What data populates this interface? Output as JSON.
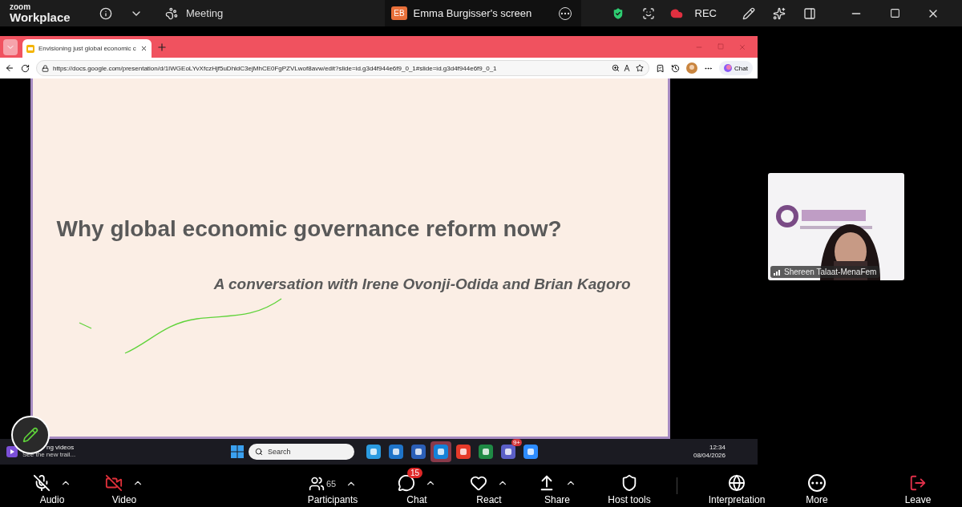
{
  "top_bar": {
    "brand_small": "zoom",
    "brand_large": "Workplace",
    "meeting_label": "Meeting",
    "share_tab": {
      "initials": "EB",
      "title": "Emma Burgisser's screen"
    },
    "rec_label": "REC"
  },
  "browser": {
    "tab_title": "Envisioning just global economic c",
    "url": "https://docs.google.com/presentation/d/1IWGEoLYvXfczHjf5uDhldC3ejMhCE0FgPZVLwof8avw/edit?slide=id.g3d4f944e6f9_0_1#slide=id.g3d4f944e6f9_0_1",
    "chat_label": "Chat"
  },
  "slide": {
    "title": "Why global economic governance reform now?",
    "subtitle": "A conversation with Irene Ovonji-Odida and Brian Kagoro"
  },
  "taskbar": {
    "notification": {
      "title": "ng videos",
      "subtitle": "See the new trail..."
    },
    "search_placeholder": "Search",
    "apps": [
      {
        "kind": "edge",
        "selected": false
      },
      {
        "kind": "people",
        "selected": false
      },
      {
        "kind": "word",
        "selected": false
      },
      {
        "kind": "outlook",
        "selected": true
      },
      {
        "kind": "pdf",
        "selected": false
      },
      {
        "kind": "excel",
        "selected": false
      },
      {
        "kind": "teams",
        "selected": false,
        "badge": "9+"
      },
      {
        "kind": "zoom",
        "selected": false
      }
    ],
    "time": "12:34",
    "date": "08/04/2026"
  },
  "participant_video": {
    "name": "Shereen Talaat-MenaFem"
  },
  "toolbar": {
    "items": [
      {
        "kind": "audio",
        "label": "Audio",
        "off": true,
        "caret": true
      },
      {
        "kind": "video",
        "label": "Video",
        "off": true,
        "caret": true
      },
      {
        "kind": "participants",
        "label": "Participants",
        "count": "65",
        "caret": true
      },
      {
        "kind": "chat",
        "label": "Chat",
        "badge": "15",
        "caret": true
      },
      {
        "kind": "react",
        "label": "React",
        "caret": true
      },
      {
        "kind": "share",
        "label": "Share",
        "caret": true
      },
      {
        "kind": "host",
        "label": "Host tools",
        "caret": false
      },
      {
        "kind": "interpretation",
        "label": "Interpretation",
        "caret": false
      },
      {
        "kind": "more",
        "label": "More",
        "caret": false
      },
      {
        "kind": "leave",
        "label": "Leave",
        "caret": false
      }
    ]
  }
}
